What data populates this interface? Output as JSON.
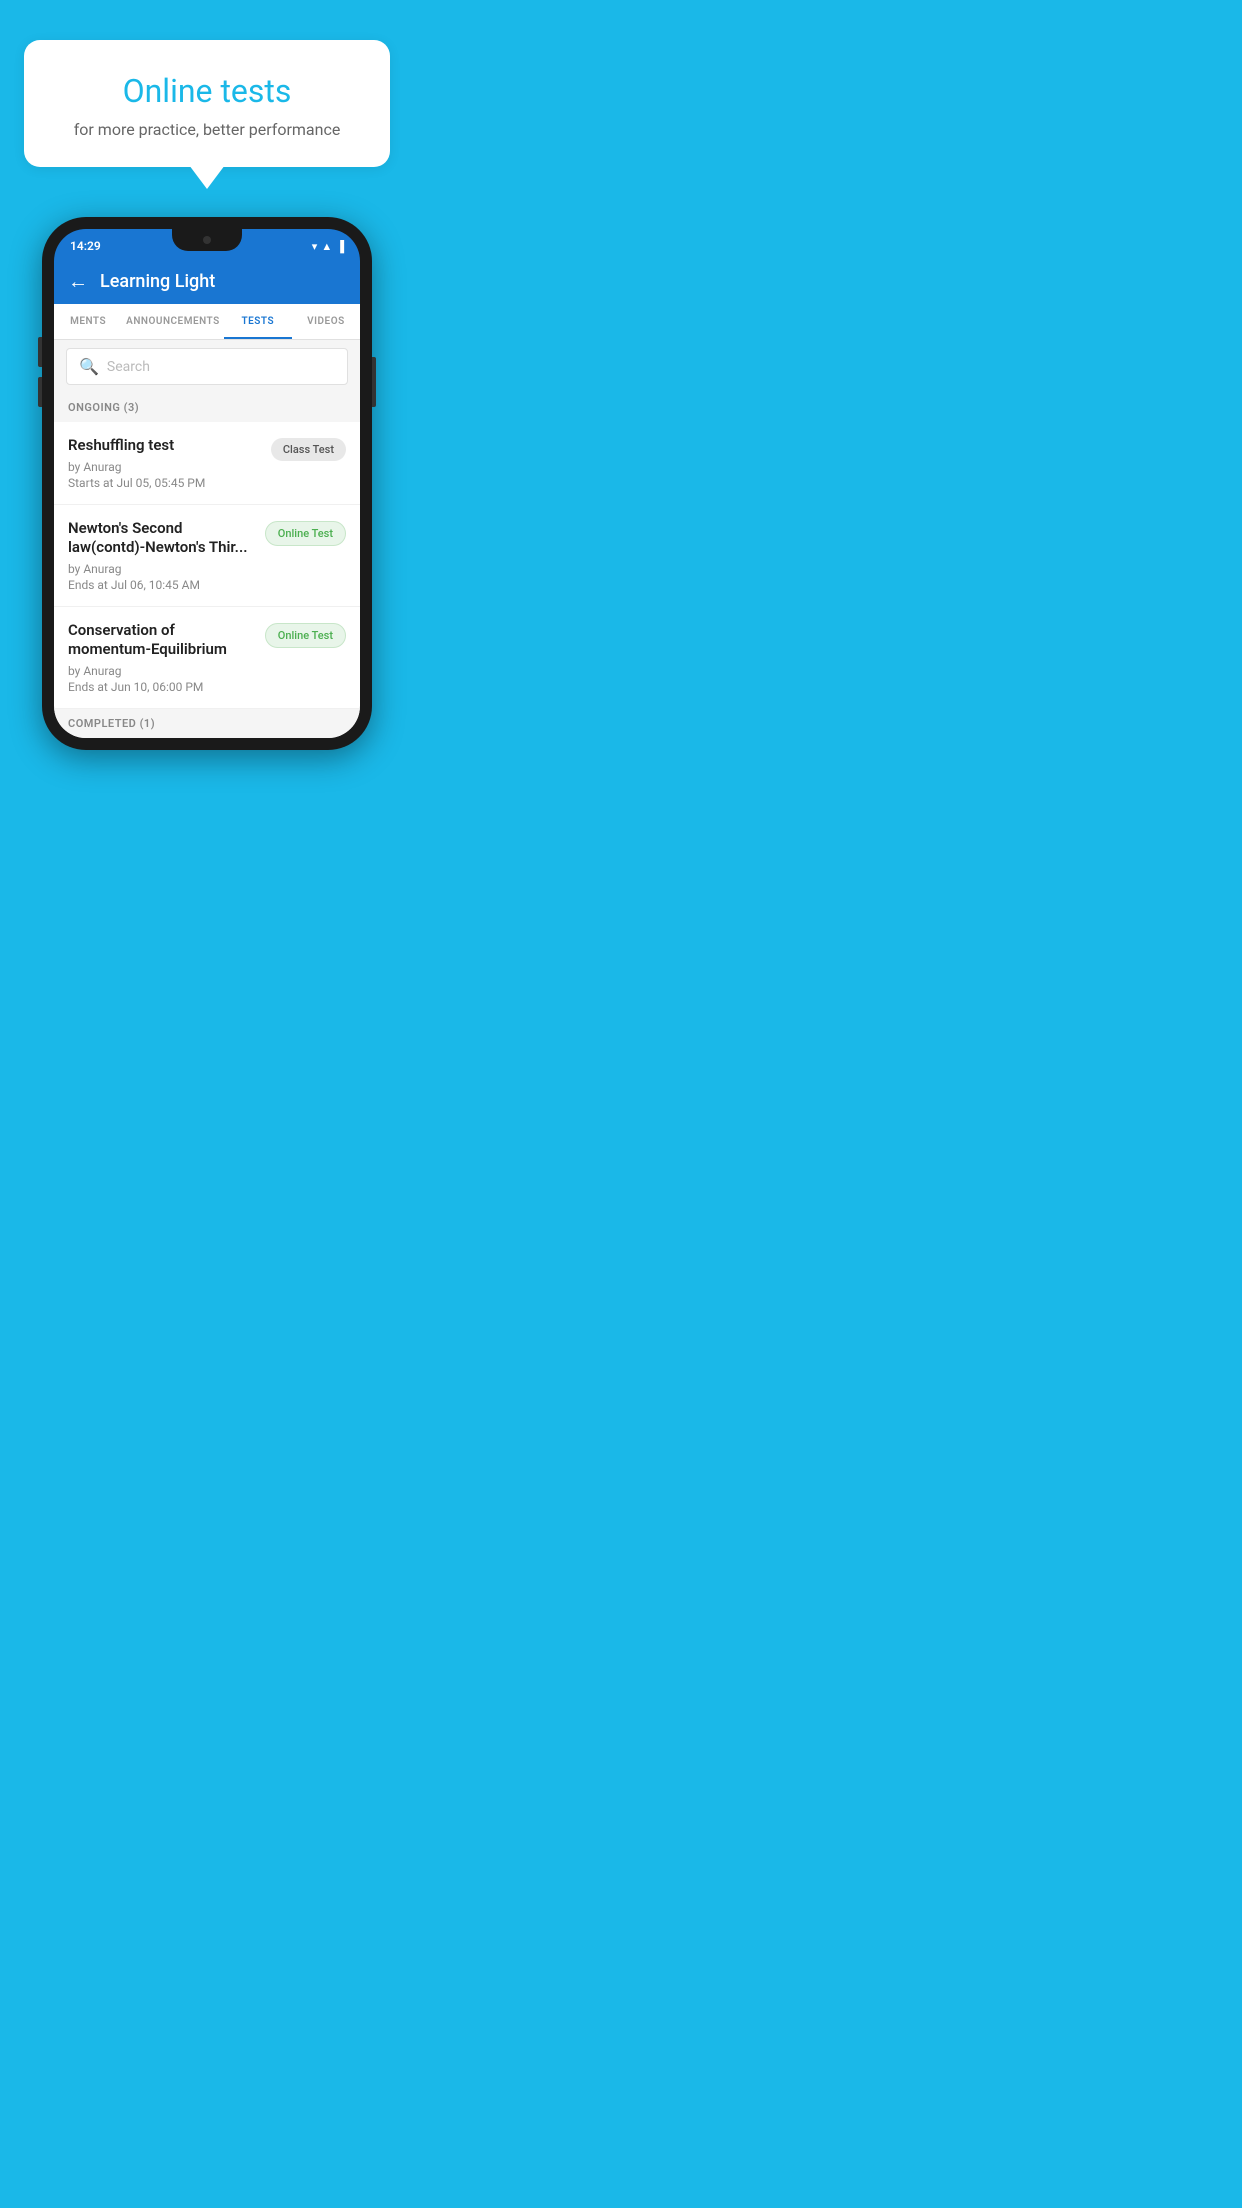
{
  "background_color": "#1ab8e8",
  "bubble": {
    "title": "Online tests",
    "subtitle": "for more practice, better performance"
  },
  "phone": {
    "status_bar": {
      "time": "14:29",
      "icons": "▼◀█"
    },
    "app_bar": {
      "title": "Learning Light",
      "back_label": "←"
    },
    "tabs": [
      {
        "label": "MENTS",
        "active": false
      },
      {
        "label": "ANNOUNCEMENTS",
        "active": false
      },
      {
        "label": "TESTS",
        "active": true
      },
      {
        "label": "VIDEOS",
        "active": false
      }
    ],
    "search": {
      "placeholder": "Search"
    },
    "ongoing_label": "ONGOING (3)",
    "tests": [
      {
        "name": "Reshuffling test",
        "author": "by Anurag",
        "time_label": "Starts at",
        "time": "Jul 05, 05:45 PM",
        "badge": "Class Test",
        "badge_type": "class"
      },
      {
        "name": "Newton's Second law(contd)-Newton's Thir...",
        "author": "by Anurag",
        "time_label": "Ends at",
        "time": "Jul 06, 10:45 AM",
        "badge": "Online Test",
        "badge_type": "online"
      },
      {
        "name": "Conservation of momentum-Equilibrium",
        "author": "by Anurag",
        "time_label": "Ends at",
        "time": "Jun 10, 06:00 PM",
        "badge": "Online Test",
        "badge_type": "online"
      }
    ],
    "completed_label": "COMPLETED (1)"
  }
}
